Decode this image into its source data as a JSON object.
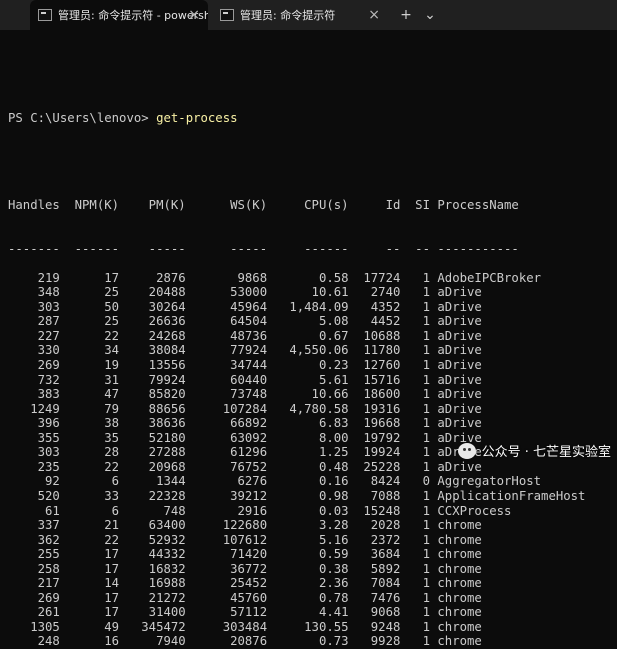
{
  "tabs": [
    {
      "label": "管理员: 命令提示符 - powersh",
      "close": "×",
      "active": true
    },
    {
      "label": "管理员: 命令提示符",
      "close": "×",
      "active": false
    }
  ],
  "tabbar_buttons": {
    "new_tab": "+",
    "dropdown": "⌄"
  },
  "terminal": {
    "prompt": "PS C:\\Users\\lenovo> ",
    "command": "get-process",
    "header": "Handles  NPM(K)    PM(K)      WS(K)     CPU(s)     Id  SI ProcessName",
    "separator": "-------  ------    -----      -----     ------     --  -- -----------",
    "rows": [
      "    219      17     2876       9868       0.58  17724   1 AdobeIPCBroker",
      "    348      25    20488      53000      10.61   2740   1 aDrive",
      "    303      50    30264      45964   1,484.09   4352   1 aDrive",
      "    287      25    26636      64504       5.08   4452   1 aDrive",
      "    227      22    24268      48736       0.67  10688   1 aDrive",
      "    330      34    38084      77924   4,550.06  11780   1 aDrive",
      "    269      19    13556      34744       0.23  12760   1 aDrive",
      "    732      31    79924      60440       5.61  15716   1 aDrive",
      "    383      47    85820      73748      10.66  18600   1 aDrive",
      "   1249      79    88656     107284   4,780.58  19316   1 aDrive",
      "    396      38    38636      66892       6.83  19668   1 aDrive",
      "    355      35    52180      63092       8.00  19792   1 aDrive",
      "    303      28    27288      61296       1.25  19924   1 aDrive",
      "    235      22    20968      76752       0.48  25228   1 aDrive",
      "     92       6     1344       6276       0.16   8424   0 AggregatorHost",
      "    520      33    22328      39212       0.98   7088   1 ApplicationFrameHost",
      "     61       6      748       2916       0.03  15248   1 CCXProcess",
      "    337      21    63400     122680       3.28   2028   1 chrome",
      "    362      22    52932     107612       5.16   2372   1 chrome",
      "    255      17    44332      71420       0.59   3684   1 chrome",
      "    258      17    16832      36772       0.38   5892   1 chrome",
      "    217      14    16988      25452       2.36   7084   1 chrome",
      "    269      17    21272      45760       0.78   7476   1 chrome",
      "    261      17    31400      57112       4.41   9068   1 chrome",
      "   1305      49   345472     303484     130.55   9248   1 chrome",
      "    248      16     7940      20876       0.73   9928   1 chrome"
    ]
  },
  "watermark": {
    "text": "公众号 · 七芒星实验室",
    "icon": "wechat-icon"
  }
}
